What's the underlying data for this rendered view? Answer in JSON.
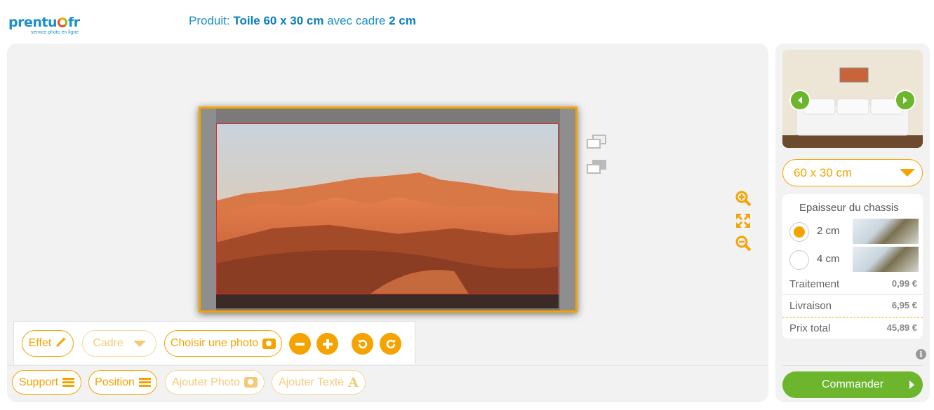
{
  "logo": {
    "brand_left": "prentu",
    "brand_right": "fr",
    "tagline": "service photo en ligne"
  },
  "header": {
    "product_prefix": "Produit:",
    "product_name": "Toile 60 x 30 cm",
    "frame_text": "avec cadre",
    "frame_value": "2 cm"
  },
  "toolbar_top": {
    "effect": "Effet",
    "frame": "Cadre",
    "choose_photo": "Choisir une photo"
  },
  "toolbar_bottom": {
    "support": "Support",
    "position": "Position",
    "add_photo": "Ajouter Photo",
    "add_text": "Ajouter Texte"
  },
  "sidebar": {
    "size_selected": "60 x 30 cm",
    "thickness_title": "Epaisseur du chassis",
    "options": [
      {
        "label": "2 cm",
        "checked": true
      },
      {
        "label": "4 cm",
        "checked": false
      }
    ],
    "prices": [
      {
        "label": "Traitement",
        "value": "0,99 €"
      },
      {
        "label": "Livraison",
        "value": "6,95 €"
      },
      {
        "label": "Prix total",
        "value": "45,89 €"
      }
    ],
    "order_button": "Commander"
  },
  "colors": {
    "accent": "#f4a300",
    "brand_blue": "#1a8fc9",
    "order_green": "#6cb52d"
  }
}
